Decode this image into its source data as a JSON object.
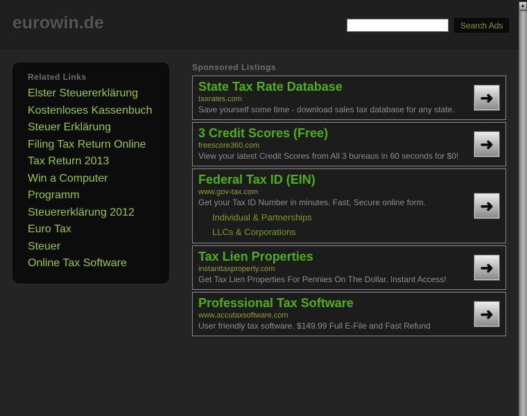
{
  "header": {
    "logo": "eurowin.de",
    "search": {
      "value": "",
      "placeholder": ""
    },
    "search_button_label": "Search Ads"
  },
  "sidebar": {
    "title": "Related Links",
    "links": [
      "Elster Steuererklärung",
      "Kostenloses Kassenbuch",
      "Steuer Erklärung",
      "Filing Tax Return Online",
      "Tax Return 2013",
      "Win a Computer",
      "Programm Steuererklärung 2012",
      "Euro Tax",
      "Steuer",
      "Online Tax Software"
    ]
  },
  "main": {
    "heading": "Sponsored Listings",
    "listings": [
      {
        "title": "State Tax Rate Database",
        "url": "taxrates.com",
        "description": "Save yourself some time - download sales tax database for any state.",
        "sublinks": []
      },
      {
        "title": "3 Credit Scores (Free)",
        "url": "freescore360.com",
        "description": "View your latest Credit Scores from All 3 bureaus in 60 seconds for $0!",
        "sublinks": []
      },
      {
        "title": "Federal Tax ID (EIN)",
        "url": "www.gov-tax.com",
        "description": "Get your Tax ID Number in minutes. Fast, Secure online form.",
        "sublinks": [
          "Individual & Partnerships",
          "LLCs & Corporations"
        ]
      },
      {
        "title": "Tax Lien Properties",
        "url": "instanttaxproperty.com",
        "description": "Get Tax Lien Properties For Pennies On The Dollar. Instant Access!",
        "sublinks": []
      },
      {
        "title": "Professional Tax Software",
        "url": "www.accutaxsoftware.com",
        "description": "User friendly tax software. $149.99 Full E-File and Fast Refund",
        "sublinks": []
      }
    ]
  },
  "icons": {
    "arrow_right": "➜",
    "scroll_up": "▲"
  },
  "colors": {
    "title_green": "#4fb00e",
    "sidebar_link_green": "#9bc832",
    "url_olive": "#8f9f30",
    "description_gray": "#8e8e8e",
    "background_dark": "#242424"
  }
}
